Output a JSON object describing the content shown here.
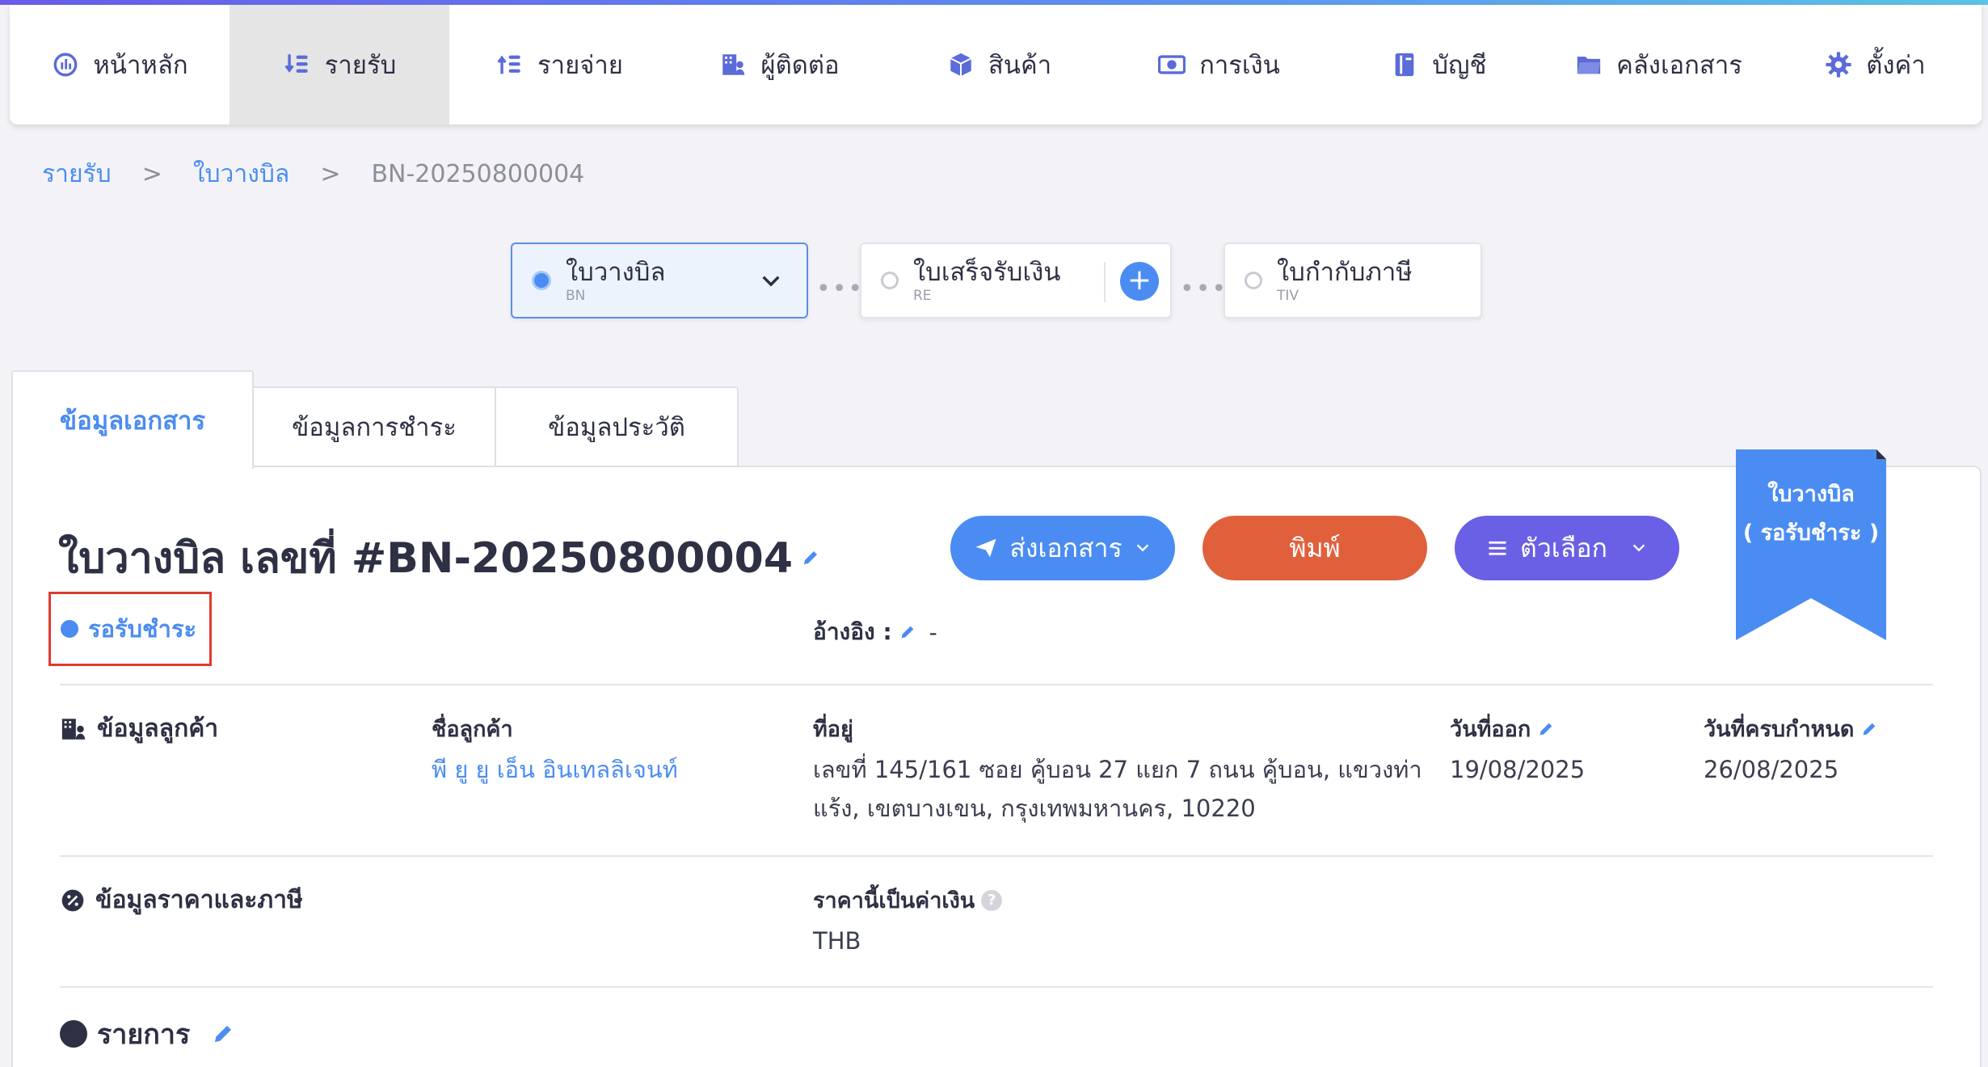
{
  "nav": {
    "items": [
      {
        "label": "หน้าหลัก",
        "icon": "dashboard-icon"
      },
      {
        "label": "รายรับ",
        "icon": "income-icon"
      },
      {
        "label": "รายจ่าย",
        "icon": "expense-icon"
      },
      {
        "label": "ผู้ติดต่อ",
        "icon": "contacts-icon"
      },
      {
        "label": "สินค้า",
        "icon": "box-icon"
      },
      {
        "label": "การเงิน",
        "icon": "money-icon"
      },
      {
        "label": "บัญชี",
        "icon": "ledger-icon"
      },
      {
        "label": "คลังเอกสาร",
        "icon": "folder-icon"
      },
      {
        "label": "ตั้งค่า",
        "icon": "gear-icon"
      }
    ],
    "active_index": 1
  },
  "breadcrumb": {
    "level1": "รายรับ",
    "level2": "ใบวางบิล",
    "current": "BN-20250800004",
    "separator": ">"
  },
  "flow": {
    "steps": [
      {
        "title": "ใบวางบิล",
        "code": "BN"
      },
      {
        "title": "ใบเสร็จรับเงิน",
        "code": "RE"
      },
      {
        "title": "ใบกำกับภาษี",
        "code": "TIV"
      }
    ],
    "connector": "•••",
    "add_symbol": "+"
  },
  "tabs": [
    {
      "label": "ข้อมูลเอกสาร"
    },
    {
      "label": "ข้อมูลการชำระ"
    },
    {
      "label": "ข้อมูลประวัติ"
    }
  ],
  "document": {
    "title": "ใบวางบิล เลขที่ #BN-20250800004",
    "status": "รอรับชำระ",
    "reference_label": "อ้างอิง :",
    "reference_value": "-",
    "ribbon_line1": "ใบวางบิล",
    "ribbon_line2": "( รอรับชำระ )"
  },
  "actions": {
    "send": "ส่งเอกสาร",
    "print": "พิมพ์",
    "options": "ตัวเลือก"
  },
  "customer": {
    "section_title": "ข้อมูลลูกค้า",
    "name_label": "ชื่อลูกค้า",
    "name_value": "พี ยู ยู เอ็น อินเทลลิเจนท์",
    "address_label": "ที่อยู่",
    "address_line1": "เลขที่ 145/161 ซอย คู้บอน 27 แยก 7 ถนน คู้บอน, แขวงท่า",
    "address_line2": "แร้ง, เขตบางเขน, กรุงเทพมหานคร, 10220",
    "issue_label": "วันที่ออก",
    "issue_value": "19/08/2025",
    "due_label": "วันที่ครบกำหนด",
    "due_value": "26/08/2025"
  },
  "pricing": {
    "section_title": "ข้อมูลราคาและภาษี",
    "currency_label": "ราคานี้เป็นค่าเงิน",
    "currency_value": "THB",
    "help_symbol": "?"
  },
  "items": {
    "section_title": "รายการ"
  },
  "colors": {
    "primary": "#4b8cf2",
    "print": "#e0603b",
    "options": "#6a60e6",
    "highlight_border": "#e03a2f"
  }
}
